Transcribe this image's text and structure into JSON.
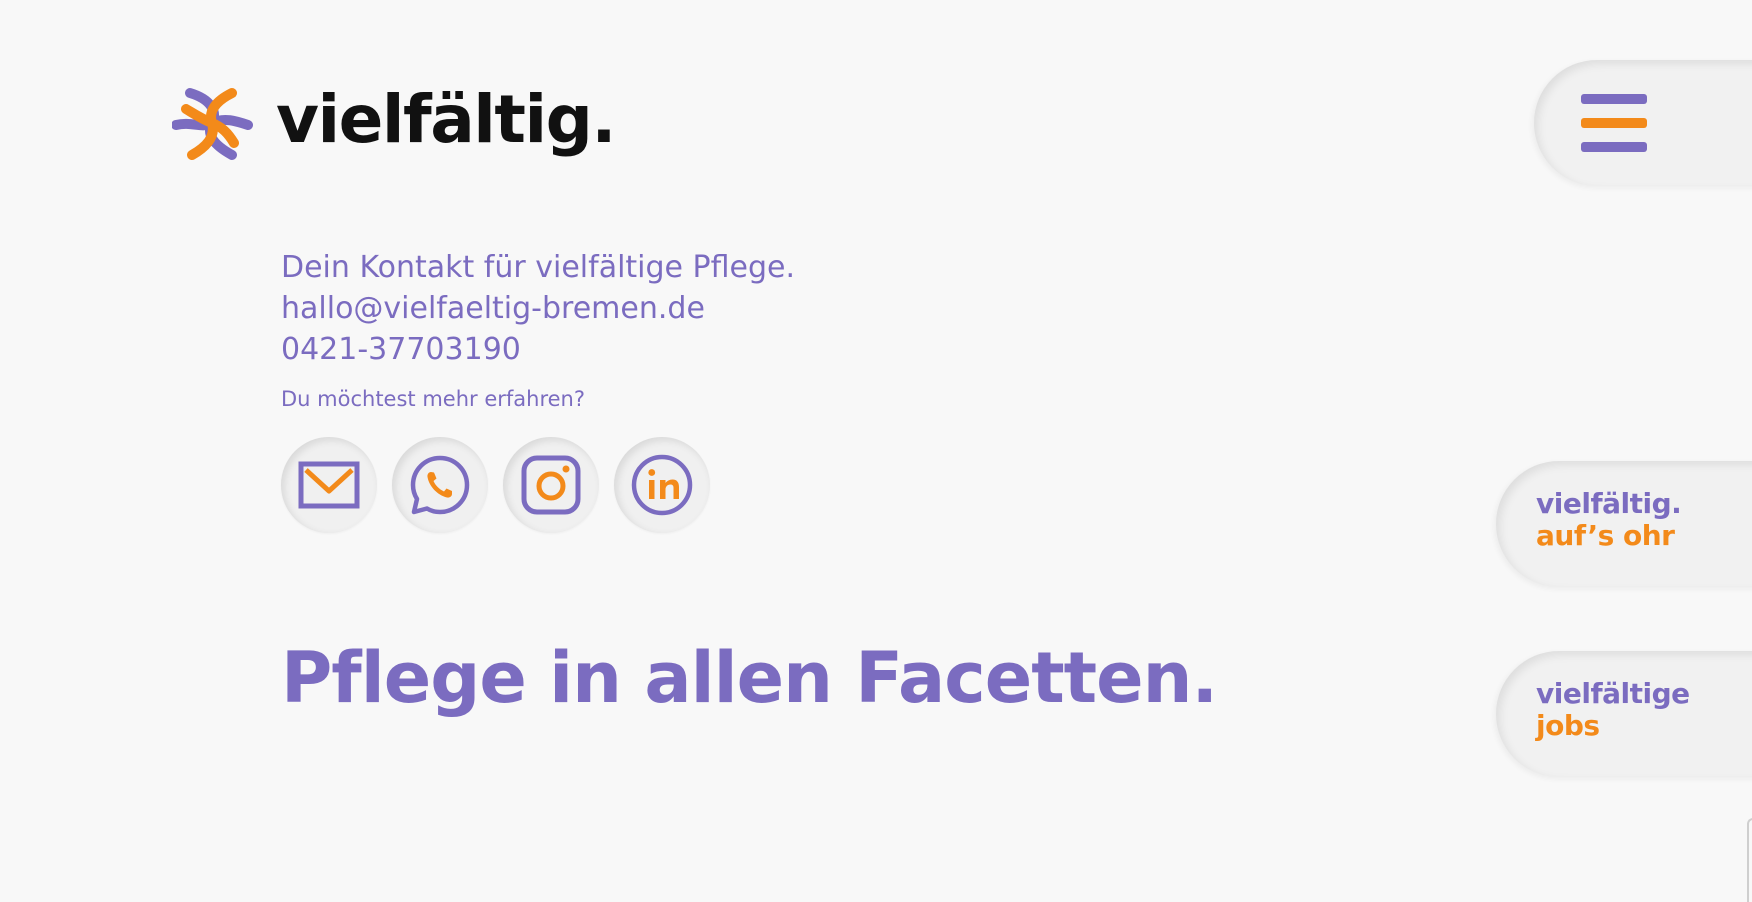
{
  "brand": {
    "name": "vielfältig.",
    "purple": "#7b6cc0",
    "orange": "#f38a1a",
    "text": "#111111",
    "background": "#f8f8f8"
  },
  "header": {
    "menu_icon": "hamburger-menu-icon"
  },
  "contact": {
    "tagline": "Dein Kontakt für vielfältige Pflege.",
    "email": "hallo@vielfaeltig-bremen.de",
    "phone": "0421-37703190",
    "more_prompt": "Du möchtest mehr erfahren?"
  },
  "socials": [
    {
      "icon": "mail-icon"
    },
    {
      "icon": "whatsapp-icon"
    },
    {
      "icon": "instagram-icon"
    },
    {
      "icon": "linkedin-icon"
    }
  ],
  "hero": {
    "headline": "Pflege in allen Facetten."
  },
  "side_links": [
    {
      "top": "vielfältig.",
      "bottom": "auf’s ohr"
    },
    {
      "top": "vielfältige",
      "bottom": "jobs"
    }
  ]
}
